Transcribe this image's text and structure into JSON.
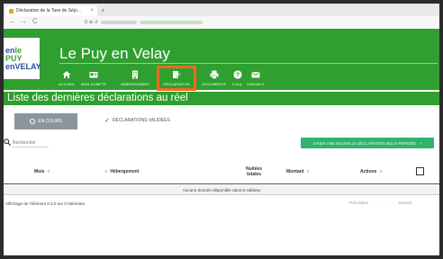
{
  "browser": {
    "tab_title": "Déclaration de la Taxe de Séjo...",
    "tab_close": "×",
    "new_tab": "+",
    "url_text": "D  ⊕  ↺",
    "back": "←",
    "forward": "→",
    "reload": "C"
  },
  "site": {
    "title": "Le Puy en Velay",
    "logo_line1_blue": "en",
    "logo_line1_green": "le PUY",
    "logo_line2": "enVELAY"
  },
  "nav": {
    "items": [
      {
        "label": "ACCUEIL",
        "icon": "home-icon"
      },
      {
        "label": "MON COMPTE",
        "icon": "account-icon"
      },
      {
        "label": "HÉBERGEMENT",
        "icon": "building-icon"
      },
      {
        "label": "DÉCLARATION",
        "icon": "declaration-icon"
      },
      {
        "label": "DOCUMENTS",
        "icon": "print-icon"
      },
      {
        "label": "F.A.Q.",
        "icon": "help-icon"
      },
      {
        "label": "CONTACT",
        "icon": "mail-icon"
      }
    ],
    "active": "DÉCLARATION",
    "highlight_color": "#f06a1e"
  },
  "page": {
    "title": "Liste des dernières déclarations au réel"
  },
  "tabs": {
    "en_cours": "EN COURS",
    "validees": "DÉCLARATIONS VALIDÉES"
  },
  "search": {
    "placeholder": "Rechercher"
  },
  "action_button": {
    "label": "SAISIR UNE NOUVELLE DÉCLARATION MULTI-PERIODE",
    "icon": "+"
  },
  "table": {
    "columns": [
      "Mois",
      "Hébergement",
      "Nuitées totales",
      "Montant",
      "Actions"
    ],
    "empty_message": "Aucune donnée disponible dans le tableau"
  },
  "footer": {
    "info": "Affichage de l'élément 0 à 0 sur 0 éléments",
    "prev": "Précédent",
    "next": "Suivant"
  },
  "colors": {
    "brand_green": "#2f9f2f",
    "button_green": "#2fb46e",
    "tab_gray": "#8a969e"
  }
}
